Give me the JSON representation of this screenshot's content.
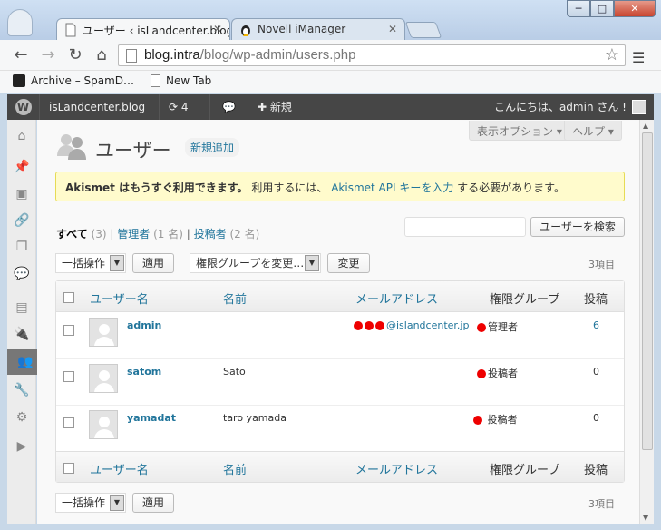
{
  "browser": {
    "tabs": [
      {
        "label": "ユーザー ‹ isLandcenter.blog — WordPress",
        "active": true
      },
      {
        "label": "Novell iManager",
        "active": false
      }
    ],
    "window_buttons": [
      "─",
      "□",
      "✕"
    ],
    "url_host": "blog.intra",
    "url_path": "/blog/wp-admin/users.php",
    "bookmarks": [
      {
        "label": "Archive – SpamD…",
        "icon": "archive-bookmark-icon"
      },
      {
        "label": "New Tab",
        "icon": "page-icon"
      }
    ]
  },
  "adminbar": {
    "wp_logo": "W",
    "site_name": "isLandcenter.blog",
    "updates_count": "4",
    "new_label": "新規",
    "greeting": "こんにちは、admin さん !"
  },
  "header": {
    "screen_options": "表示オプション ▾",
    "help": "ヘルプ ▾",
    "title": "ユーザー",
    "add_new": "新規追加"
  },
  "notice": {
    "bold": "Akismet はもうすぐ利用できます。",
    "text_before": "利用するには、",
    "link": "Akismet API キーを入力",
    "text_after": "する必要があります。"
  },
  "filters": {
    "all_label": "すべて",
    "all_count": "(3)",
    "admin_label": "管理者",
    "admin_count": "(1 名)",
    "author_label": "投稿者",
    "author_count": "(2 名)",
    "sep": "|"
  },
  "search": {
    "button": "ユーザーを検索",
    "value": ""
  },
  "bulk": {
    "action": "一括操作",
    "apply": "適用",
    "role_select": "権限グループを変更…",
    "change": "変更",
    "item_count": "3項目"
  },
  "table": {
    "columns": {
      "username": "ユーザー名",
      "name": "名前",
      "email": "メールアドレス",
      "role": "権限グループ",
      "posts": "投稿"
    },
    "rows": [
      {
        "username": "admin",
        "name": "",
        "email": "@islandcenter.jp",
        "role": "管理者",
        "posts": "6"
      },
      {
        "username": "satom",
        "name": "Sato",
        "email": "",
        "role": "投稿者",
        "posts": "0"
      },
      {
        "username": "yamadat",
        "name": "taro yamada",
        "email": "",
        "role": "投稿者",
        "posts": "0"
      }
    ]
  },
  "colors": {
    "link": "#21759b",
    "adminbar": "#464646",
    "redaction": "#e00000",
    "notice_bg": "#fffbcc"
  }
}
